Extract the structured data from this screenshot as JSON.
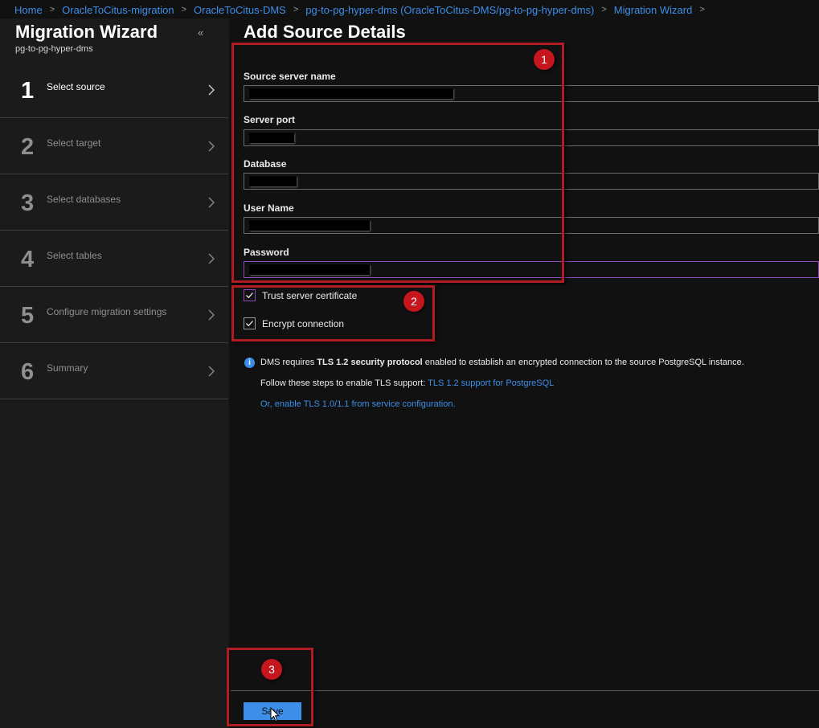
{
  "breadcrumb": [
    {
      "label": "Home"
    },
    {
      "label": "OracleToCitus-migration"
    },
    {
      "label": "OracleToCitus-DMS"
    },
    {
      "label": "pg-to-pg-hyper-dms (OracleToCitus-DMS/pg-to-pg-hyper-dms)"
    },
    {
      "label": "Migration Wizard"
    }
  ],
  "sidebar": {
    "title": "Migration Wizard",
    "subtitle": "pg-to-pg-hyper-dms",
    "collapse_icon": "«",
    "steps": [
      {
        "number": "1",
        "label": "Select source",
        "active": true
      },
      {
        "number": "2",
        "label": "Select target",
        "active": false
      },
      {
        "number": "3",
        "label": "Select databases",
        "active": false
      },
      {
        "number": "4",
        "label": "Select tables",
        "active": false
      },
      {
        "number": "5",
        "label": "Configure migration settings",
        "active": false
      },
      {
        "number": "6",
        "label": "Summary",
        "active": false
      }
    ]
  },
  "main": {
    "title": "Add Source Details",
    "fields": {
      "source_server_name": {
        "label": "Source server name",
        "value": "[redacted]"
      },
      "server_port": {
        "label": "Server port",
        "value": "[redacted]"
      },
      "database": {
        "label": "Database",
        "value": "[redacted]"
      },
      "user_name": {
        "label": "User Name",
        "value": "[redacted]"
      },
      "password": {
        "label": "Password",
        "value": "[redacted]"
      }
    },
    "trust_cert": {
      "label": "Trust server certificate",
      "checked": true
    },
    "encrypt": {
      "label": "Encrypt connection",
      "checked": true
    },
    "info": {
      "prefix": "DMS requires ",
      "bold": "TLS 1.2 security protocol",
      "suffix": " enabled to establish an encrypted connection to the source PostgreSQL instance.",
      "steps_text": "Follow these steps to enable TLS support: ",
      "steps_link": "TLS 1.2 support for PostgreSQL",
      "alt_link": "Or, enable TLS 1.0/1.1 from service configuration."
    },
    "save_label": "Save"
  },
  "annotations": {
    "badge1": "1",
    "badge2": "2",
    "badge3": "3"
  },
  "colors": {
    "accent": "#3d8ee8",
    "annotation": "#c4161c",
    "focus": "#8a4bb8",
    "background": "#111111"
  }
}
